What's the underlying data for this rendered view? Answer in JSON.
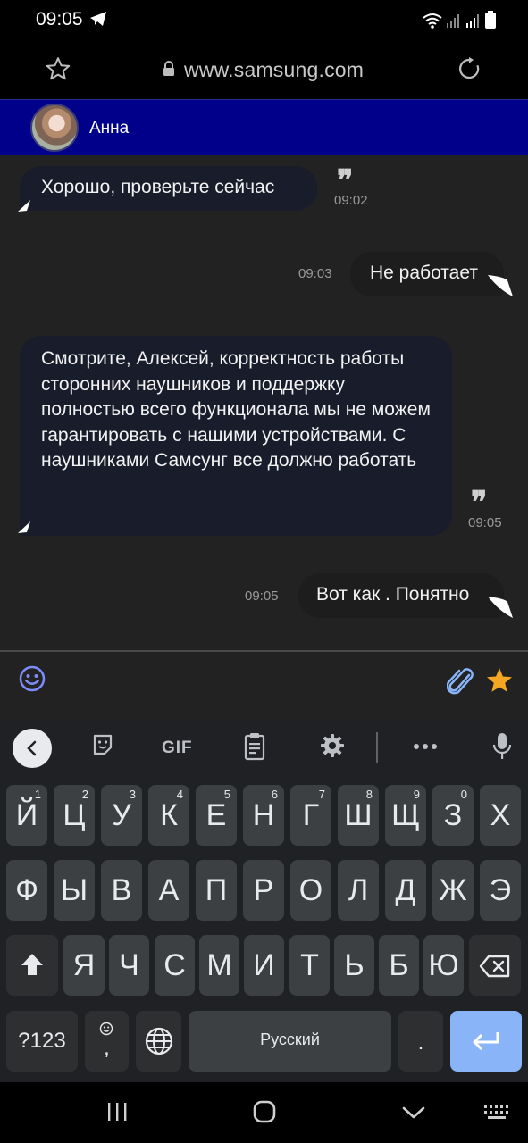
{
  "status_bar": {
    "time": "09:05"
  },
  "browser": {
    "url": "www.samsung.com"
  },
  "chat": {
    "contact_name": "Анна",
    "messages": [
      {
        "direction": "in",
        "text": "Хорошо, проверьте сейчас",
        "time": "09:02",
        "read": true
      },
      {
        "direction": "out",
        "text": "Не работает",
        "time": "09:03"
      },
      {
        "direction": "in",
        "text": "Смотрите, Алексей, корректность работы сторонних наушников и поддержку полностью всего функционала мы не можем гарантировать с нашими устройствами. С наушниками Самсунг все должно работать",
        "time": "09:05",
        "read": true
      },
      {
        "direction": "out",
        "text": "Вот как . Понятно",
        "time": "09:05"
      }
    ]
  },
  "keyboard": {
    "toolbar_gif": "GIF",
    "row1": [
      {
        "ch": "Й",
        "num": "1"
      },
      {
        "ch": "Ц",
        "num": "2"
      },
      {
        "ch": "У",
        "num": "3"
      },
      {
        "ch": "К",
        "num": "4"
      },
      {
        "ch": "Е",
        "num": "5"
      },
      {
        "ch": "Н",
        "num": "6"
      },
      {
        "ch": "Г",
        "num": "7"
      },
      {
        "ch": "Ш",
        "num": "8"
      },
      {
        "ch": "Щ",
        "num": "9"
      },
      {
        "ch": "З",
        "num": "0"
      },
      {
        "ch": "Х",
        "num": ""
      }
    ],
    "row2": [
      "Ф",
      "Ы",
      "В",
      "А",
      "П",
      "Р",
      "О",
      "Л",
      "Д",
      "Ж",
      "Э"
    ],
    "row3": [
      "Я",
      "Ч",
      "С",
      "М",
      "И",
      "Т",
      "Ь",
      "Б",
      "Ю"
    ],
    "symbols_label": "?123",
    "comma_label": ",",
    "space_label": "Русский",
    "period_label": "."
  },
  "colors": {
    "header_bg": "#00008b",
    "accent_star": "#f5a623",
    "icon_blue": "#8ab4f8"
  }
}
